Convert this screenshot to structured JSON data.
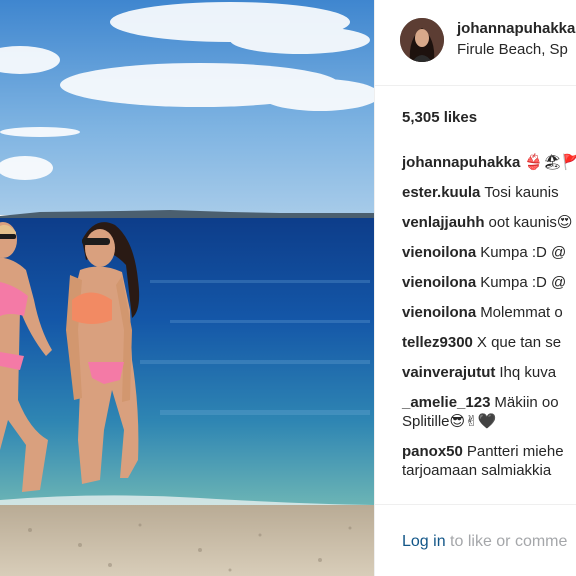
{
  "post": {
    "username": "johannapuhakka",
    "location": "Firule Beach, Sp",
    "likes": "5,305 likes"
  },
  "comments": [
    {
      "user": "johannapuhakka",
      "text": "👙🏖🚩"
    },
    {
      "user": "ester.kuula",
      "text": "Tosi kaunis"
    },
    {
      "user": "venlajjauhh",
      "text": "oot kaunis😍"
    },
    {
      "user": "vienoilona",
      "text": "Kumpa :D @"
    },
    {
      "user": "vienoilona",
      "text": "Kumpa :D @"
    },
    {
      "user": "vienoilona",
      "text": "Molemmat o"
    },
    {
      "user": "tellez9300",
      "text": "X que tan se"
    },
    {
      "user": "vainverajutut",
      "text": "Ihq kuva"
    },
    {
      "user": "_amelie_123",
      "text": "Mäkiin oo",
      "text2": "Splitille😎✌🖤"
    },
    {
      "user": "panox50",
      "text": "Pantteri miehe",
      "text2": "tarjoamaan salmiakkia"
    }
  ],
  "footer": {
    "login_link": "Log in",
    "login_rest": " to like or comme"
  },
  "icons": {
    "avatar": "profile-photo"
  }
}
